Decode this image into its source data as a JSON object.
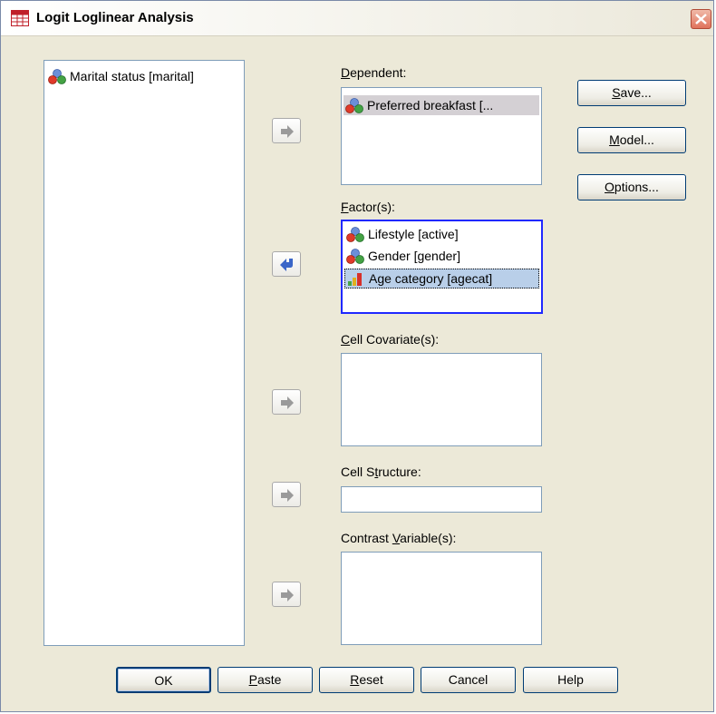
{
  "window": {
    "title": "Logit Loglinear Analysis"
  },
  "source_list": {
    "items": [
      {
        "label": "Marital status [marital]",
        "icon": "nominal-variable-icon"
      }
    ]
  },
  "dependent": {
    "label_pre": "",
    "label_key": "D",
    "label_post": "ependent:",
    "items": [
      {
        "label": "Preferred breakfast [...",
        "icon": "nominal-variable-icon"
      }
    ]
  },
  "factors": {
    "label_pre": "",
    "label_key": "F",
    "label_post": "actor(s):",
    "items": [
      {
        "label": "Lifestyle [active]",
        "icon": "nominal-variable-icon"
      },
      {
        "label": "Gender [gender]",
        "icon": "nominal-variable-icon"
      },
      {
        "label": "Age category [agecat]",
        "icon": "ordinal-variable-icon"
      }
    ]
  },
  "cell_covariates": {
    "label_pre": "",
    "label_key": "C",
    "label_post": "ell Covariate(s):"
  },
  "cell_structure": {
    "label_pre": "Cell S",
    "label_key": "t",
    "label_post": "ructure:",
    "value": ""
  },
  "contrast_variables": {
    "label_pre": "Contrast ",
    "label_key": "V",
    "label_post": "ariable(s):"
  },
  "side_buttons": {
    "save": {
      "pre": "",
      "key": "S",
      "post": "ave..."
    },
    "model": {
      "pre": "",
      "key": "M",
      "post": "odel..."
    },
    "options": {
      "pre": "",
      "key": "O",
      "post": "ptions..."
    }
  },
  "bottom_buttons": {
    "ok": "OK",
    "paste": {
      "pre": "",
      "key": "P",
      "post": "aste"
    },
    "reset": {
      "pre": "",
      "key": "R",
      "post": "eset"
    },
    "cancel": "Cancel",
    "help": "Help"
  },
  "colors": {
    "accent": "#1f28ff",
    "selection_gray": "#d4d0d4",
    "selection_blue": "#b9cfe9",
    "dialog_bg": "#ece9d8"
  }
}
